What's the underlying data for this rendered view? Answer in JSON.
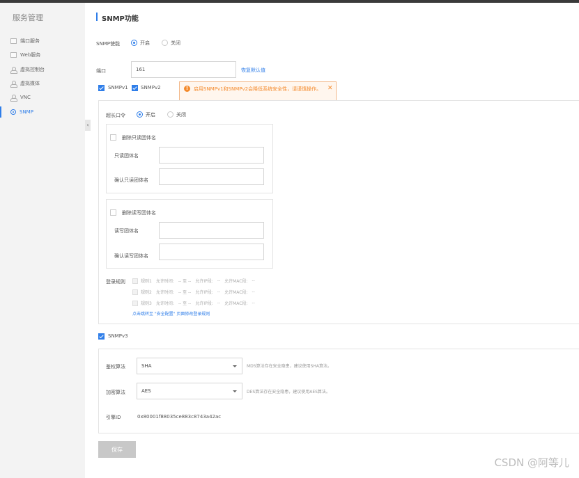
{
  "sidebar": {
    "title": "服务管理",
    "items": [
      {
        "label": "端口服务",
        "icon": "square-icon",
        "active": false
      },
      {
        "label": "Web服务",
        "icon": "square-icon",
        "active": false
      },
      {
        "label": "虚拟控制台",
        "icon": "user-icon",
        "active": false
      },
      {
        "label": "虚拟媒体",
        "icon": "user-icon",
        "active": false
      },
      {
        "label": "VNC",
        "icon": "user-icon",
        "active": false
      },
      {
        "label": "SNMP",
        "icon": "gear-icon",
        "active": true
      }
    ],
    "collapse_glyph": "‹"
  },
  "page": {
    "title": "SNMP功能"
  },
  "snmp_enable": {
    "label": "SNMP使能",
    "on_label": "开启",
    "off_label": "关闭",
    "selected": "on"
  },
  "port": {
    "label": "端口",
    "value": "161",
    "restore_link": "恢复默认值"
  },
  "versions": {
    "v1_label": "SNMPv1",
    "v1_checked": true,
    "v2_label": "SNMPv2",
    "v2_checked": true
  },
  "warning": {
    "icon": "warning-icon",
    "text": "启用SNMPv1和SNMPv2会降低系统安全性，请谨慎操作。",
    "close_glyph": "✕",
    "color": "#f48a2c"
  },
  "long_password": {
    "label": "超长口令",
    "on_label": "开启",
    "off_label": "关闭",
    "selected": "on"
  },
  "readonly_community": {
    "delete_label": "删除只读团体名",
    "name_label": "只读团体名",
    "confirm_label": "确认只读团体名",
    "name_value": "",
    "confirm_value": ""
  },
  "readwrite_community": {
    "delete_label": "删除读写团体名",
    "name_label": "读写团体名",
    "confirm_label": "确认读写团体名",
    "name_value": "",
    "confirm_value": ""
  },
  "login_rules": {
    "label": "登录规则",
    "rules": [
      {
        "name": "规则1",
        "time_label": "允许时间:",
        "time_value": "-- 至 --",
        "ip_label": "允许IP段:",
        "ip_value": "--",
        "mac_label": "允许MAC段:",
        "mac_value": "--"
      },
      {
        "name": "规则2",
        "time_label": "允许时间:",
        "time_value": "-- 至 --",
        "ip_label": "允许IP段:",
        "ip_value": "--",
        "mac_label": "允许MAC段:",
        "mac_value": "--"
      },
      {
        "name": "规则3",
        "time_label": "允许时间:",
        "time_value": "-- 至 --",
        "ip_label": "允许IP段:",
        "ip_value": "--",
        "mac_label": "允许MAC段:",
        "mac_value": "--"
      }
    ],
    "link": "点击跳转至 \"安全配置\" 页面修改登录规则"
  },
  "snmpv3": {
    "label": "SNMPv3",
    "checked": true,
    "auth_label": "鉴权算法",
    "auth_value": "SHA",
    "auth_hint": "MD5算法存在安全隐患，建议使用SHA算法。",
    "enc_label": "加密算法",
    "enc_value": "AES",
    "enc_hint": "DES算法存在安全隐患，建议使用AES算法。",
    "engine_label": "引擎ID",
    "engine_value": "0x80001f88035ce883c8743a42ac"
  },
  "save_label": "保存",
  "watermark": "CSDN @阿等儿",
  "colors": {
    "accent": "#2f7ee9",
    "warning": "#f48a2c"
  }
}
